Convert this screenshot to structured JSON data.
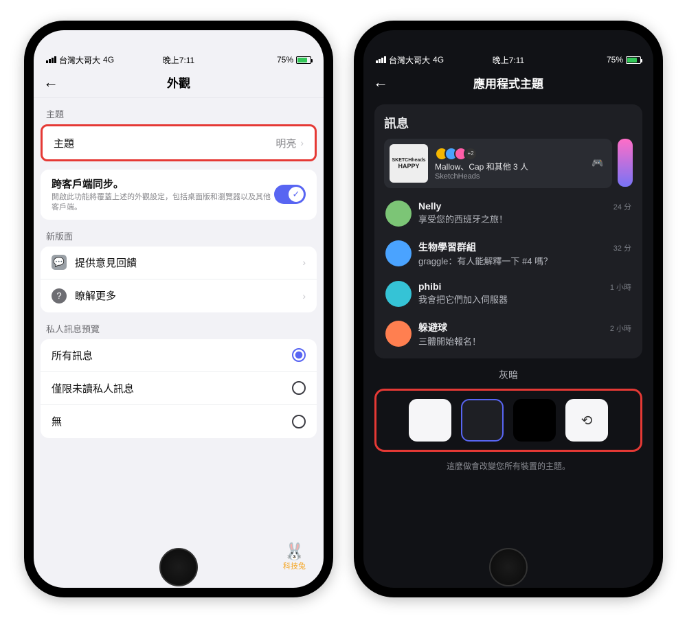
{
  "status": {
    "carrier": "台灣大哥大",
    "net": "4G",
    "time": "晚上7:11",
    "battery": "75%"
  },
  "left": {
    "title": "外觀",
    "sections": {
      "theme": {
        "label": "主題",
        "row_label": "主題",
        "row_value": "明亮"
      },
      "sync": {
        "title": "跨客戶端同步。",
        "desc": "開啟此功能將覆蓋上述的外觀設定，包括桌面版和瀏覽器以及其他客戶端。"
      },
      "new_layout": {
        "label": "新版面",
        "feedback": "提供意見回饋",
        "learn": "瞭解更多"
      },
      "dm_preview": {
        "label": "私人訊息預覽",
        "opts": [
          "所有訊息",
          "僅限未讀私人訊息",
          "無"
        ]
      }
    }
  },
  "right": {
    "title": "應用程式主題",
    "panel_title": "訊息",
    "activity": {
      "title": "Mallow、Cap 和其他 3 人",
      "subtitle": "SketchHeads",
      "badge": "+2",
      "thumb_top": "SKETCHheads",
      "thumb_mid": "HAPPY"
    },
    "messages": [
      {
        "name": "Nelly",
        "text": "享受您的西班牙之旅！",
        "time": "24 分",
        "color": "#7cc576"
      },
      {
        "name": "生物學習群組",
        "text": "graggle：有人能解釋一下 #4 嗎？",
        "time": "32 分",
        "color": "#4aa3ff"
      },
      {
        "name": "phibi",
        "text": "我會把它們加入伺服器",
        "time": "1 小時",
        "color": "#35c3d6"
      },
      {
        "name": "躲避球",
        "text": "三體開始報名！",
        "time": "2 小時",
        "color": "#ff7f50"
      }
    ],
    "theme_label": "灰暗",
    "foot": "這麼做會改變您所有裝置的主題。"
  },
  "watermark": "科技兔"
}
